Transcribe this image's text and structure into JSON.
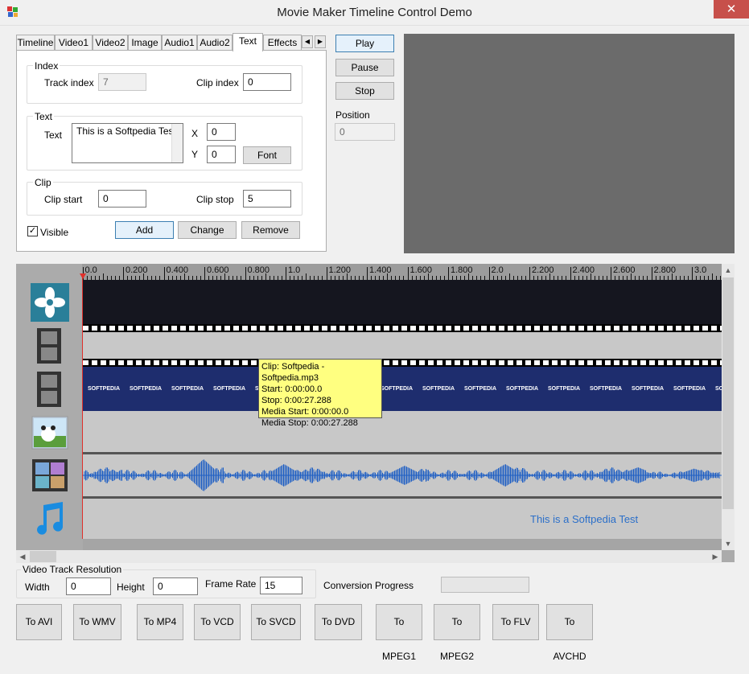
{
  "window": {
    "title": "Movie Maker Timeline Control Demo",
    "close_label": "✕"
  },
  "tabs": [
    {
      "label": "Timeline"
    },
    {
      "label": "Video1"
    },
    {
      "label": "Video2"
    },
    {
      "label": "Image"
    },
    {
      "label": "Audio1"
    },
    {
      "label": "Audio2"
    },
    {
      "label": "Text"
    },
    {
      "label": "Effects"
    }
  ],
  "tab_scroll": {
    "left": "◀",
    "right": "▶"
  },
  "index_group": {
    "title": "Index",
    "track_label": "Track index",
    "track_value": "7",
    "clip_label": "Clip index",
    "clip_value": "0"
  },
  "text_group": {
    "title": "Text",
    "text_label": "Text",
    "text_value": "This is a Softpedia Test",
    "x_label": "X",
    "x_value": "0",
    "y_label": "Y",
    "y_value": "0",
    "font_button": "Font"
  },
  "clip_group": {
    "title": "Clip",
    "start_label": "Clip start",
    "start_value": "0",
    "stop_label": "Clip stop",
    "stop_value": "5"
  },
  "visible": {
    "label": "Visible",
    "checked": true
  },
  "actions": {
    "add": "Add",
    "change": "Change",
    "remove": "Remove"
  },
  "playback": {
    "play": "Play",
    "pause": "Pause",
    "stop": "Stop",
    "position_label": "Position",
    "position_value": "0"
  },
  "ruler": [
    "0.0",
    "0.200",
    "0.400",
    "0.600",
    "0.800",
    "1.0",
    "1.200",
    "1.400",
    "1.600",
    "1.800",
    "2.0",
    "2.200",
    "2.400",
    "2.600",
    "2.800",
    "3.0"
  ],
  "video_clip_text": [
    "SOFTPEDIA",
    "SOFTPEDIA",
    "SOFTPEDIA",
    "SOFTPEDIA",
    "SOFTPEDIA",
    "SOFTPEDIA",
    "SOFTPEDIA",
    "SOFTPEDIA",
    "SOFTPEDIA",
    "SOFTPEDIA",
    "SOFTPEDIA",
    "SOFTPEDIA",
    "SOFTPEDIA",
    "SOFTPEDIA",
    "SOFTPEDIA",
    "SOFTPEDIA"
  ],
  "text_track_caption": "This is a Softpedia Test",
  "tooltip": {
    "clip": "Clip: Softpedia - Softpedia.mp3",
    "start": "Start: 0:00:00.0",
    "stop": "Stop: 0:00:27.288",
    "media_start": "Media Start: 0:00:00.0",
    "media_stop": "Media Stop: 0:00:27.288"
  },
  "resolution": {
    "title": "Video Track Resolution",
    "width_label": "Width",
    "width_value": "0",
    "height_label": "Height",
    "height_value": "0",
    "framerate_label": "Frame Rate",
    "framerate_value": "15",
    "progress_label": "Conversion Progress",
    "progress": 0
  },
  "convert_buttons": [
    "To AVI",
    "To WMV",
    "To MP4",
    "To VCD",
    "To SVCD",
    "To DVD",
    "To MPEG1",
    "To MPEG2",
    "To FLV",
    "To AVCHD"
  ],
  "icons": {
    "track1": "windmill-icon",
    "track2": "film-strip-icon",
    "track3": "film-strip-icon",
    "track4": "photo-icon",
    "track5": "video-collage-icon",
    "track6": "music-note-icon"
  },
  "colors": {
    "video_clip": "#1e2d6e",
    "waveform": "#1f5fc4",
    "text_caption": "#2b6fc9",
    "playhead": "#e0302b",
    "tooltip": "#ffff80"
  }
}
